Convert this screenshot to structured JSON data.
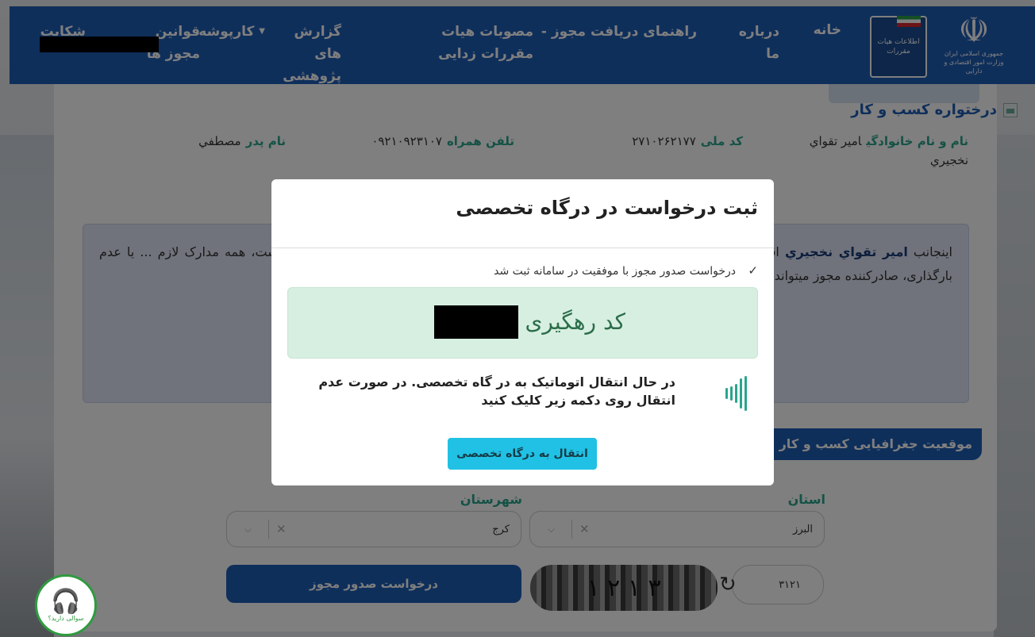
{
  "header": {
    "nav": {
      "home": "خانه",
      "about": "درباره ما",
      "guide": "راهنمای دریافت مجوز -",
      "resolutions": "مصوبات هیات مقررات زدایی",
      "research": "گزارش های پژوهشی",
      "kariposhe": "کارپوشه",
      "laws": "قوانین مجوز ها",
      "complaint": "شکایت"
    },
    "logo_emblem_text": "جمهوری اسلامی ایران وزارت امور اقتصادی و دارایی",
    "logo_ministry_text": "اطلاعات هیات مقررات"
  },
  "page": {
    "title": "درختواره کسب و کار",
    "info": {
      "name_label": "نام و نام خانوادگی",
      "name_value": "امیر تقواي نخجيري",
      "national_id_label": "کد ملی",
      "national_id_value": "۲۷۱۰۲۶۲۱۷۷",
      "mobile_label": "تلفن همراه",
      "mobile_value": "۰۹۲۱۰۹۲۳۱۰۷",
      "father_label": "نام پدر",
      "father_value": "مصطفي"
    },
    "notice": {
      "prefix": "اینجانب ",
      "name": "امیر تقواي نخجيري",
      "body_right": "اقرارمیکنم شرایط و مدارک لازم برای دریافت این مجوز ... ۲۴ساعت پس از ثبت این درخواست، همه مدارک لازم ... یا عدم بارگذاری، صادرکننده مجوز میتواند درخواستم را رد"
    },
    "geo_tab": "موقعیت جغرافیایی کسب و کار",
    "province_label": "استان",
    "province_value": "البرز",
    "city_label": "شهرستان",
    "city_value": "کرج",
    "submit_label": "درخواست صدور مجوز",
    "captcha_text": "۳ ۱ ۲ ۱",
    "captcha_input_value": "۳۱۲۱",
    "support_text": "سوالی دارید؟"
  },
  "modal": {
    "title": "ثبت درخواست در درگاه تخصصی",
    "success_message": "درخواست صدور مجوز با موفقیت در سامانه ثبت شد",
    "tracking_label": "کد رهگیری :",
    "transfer_message": "در حال انتقال اتوماتیک به در گاه تخصصی. در صورت عدم انتقال روی دکمه زیر کلیک کنید",
    "transfer_button": "انتقال به درگاه تخصصی"
  },
  "colors": {
    "header_blue": "#1f5fb7",
    "accent_teal": "#2aa58d",
    "success_bg": "#d7efe1",
    "button_cyan": "#20c1e4"
  }
}
